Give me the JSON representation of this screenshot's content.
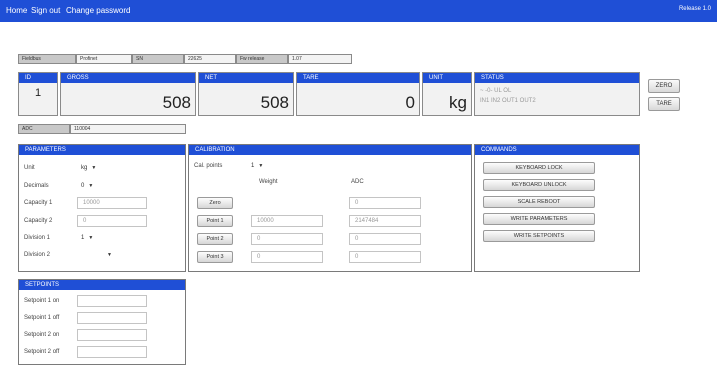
{
  "nav": {
    "home": "Home",
    "sign_out": "Sign out",
    "change_password": "Change password",
    "release": "Release 1.0"
  },
  "info": {
    "fieldbus_label": "Fieldbus",
    "fieldbus_value": "Profinet",
    "sn_label": "SN",
    "sn_value": "22625",
    "fw_label": "Fw release",
    "fw_value": "1.07"
  },
  "readout": {
    "id_label": "ID",
    "id_value": "1",
    "gross_label": "GROSS",
    "gross_value": "508",
    "net_label": "NET",
    "net_value": "508",
    "tare_label": "TARE",
    "tare_value": "0",
    "unit_label": "UNIT",
    "unit_value": "kg",
    "status_label": "STATUS",
    "status_line1": "~   -0-   UL   OL",
    "status_line2": "IN1 IN2 OUT1 OUT2"
  },
  "buttons": {
    "zero": "ZERO",
    "tare": "TARE"
  },
  "adc": {
    "label": "ADC",
    "value": "110004"
  },
  "parameters": {
    "title": "PARAMETERS",
    "unit_label": "Unit",
    "unit_value": "kg",
    "decimals_label": "Decimals",
    "decimals_value": "0",
    "capacity1_label": "Capacity 1",
    "capacity1_value": "10000",
    "capacity2_label": "Capacity 2",
    "capacity2_value": "0",
    "division1_label": "Division 1",
    "division1_value": "1",
    "division2_label": "Division 2",
    "division2_value": ""
  },
  "calibration": {
    "title": "CALIBRATION",
    "cal_points_label": "Cal. points",
    "cal_points_value": "1",
    "weight_header": "Weight",
    "adc_header": "ADC",
    "zero_button": "Zero",
    "zero_adc": "0",
    "point1_button": "Point 1",
    "point1_weight": "10000",
    "point1_adc": "2147484",
    "point2_button": "Point 2",
    "point2_weight": "0",
    "point2_adc": "0",
    "point3_button": "Point 3",
    "point3_weight": "0",
    "point3_adc": "0"
  },
  "commands": {
    "title": "COMMANDS",
    "keyboard_lock": "KEYBOARD LOCK",
    "keyboard_unlock": "KEYBOARD UNLOCK",
    "scale_reboot": "SCALE REBOOT",
    "write_parameters": "WRITE PARAMETERS",
    "write_setpoints": "WRITE SETPOINTS"
  },
  "setpoints": {
    "title": "SETPOINTS",
    "sp1_on_label": "Setpoint 1 on",
    "sp1_off_label": "Setpoint 1 off",
    "sp2_on_label": "Setpoint 2 on",
    "sp2_off_label": "Setpoint 2 off"
  },
  "colors": {
    "accent": "#1f4fd6",
    "panel_bg": "#f2f2f2",
    "label_bg": "#c8c8c8"
  }
}
